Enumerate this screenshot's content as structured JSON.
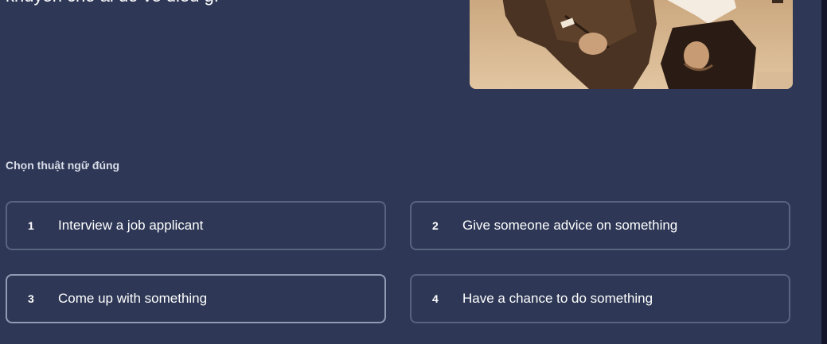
{
  "question": {
    "text": "khuyên cho ai đó về điều gì"
  },
  "prompt_label": "Chọn thuật ngữ đúng",
  "options": [
    {
      "number": "1",
      "label": "Interview a job applicant"
    },
    {
      "number": "2",
      "label": "Give someone advice on something"
    },
    {
      "number": "3",
      "label": "Come up with something"
    },
    {
      "number": "4",
      "label": "Have a chance to do something"
    }
  ],
  "colors": {
    "background": "#2e3856",
    "option_border": "#586380",
    "option_border_hover": "#939bb4",
    "photo_tone": "#d8b794"
  }
}
